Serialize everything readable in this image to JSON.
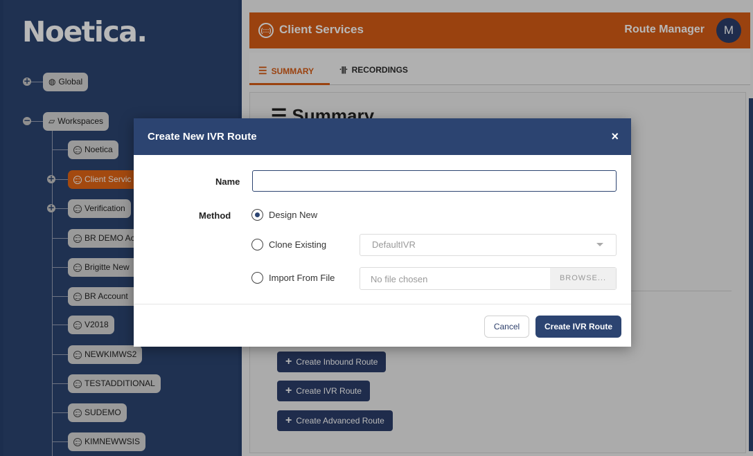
{
  "sidebar": {
    "logo": "Noetica.",
    "global": {
      "toggle": "+",
      "icon": "globe-icon",
      "label": "Global"
    },
    "workspaces": {
      "toggle": "−",
      "icon": "folder-open-icon",
      "label": "Workspaces"
    },
    "items": [
      {
        "label": "Noetica",
        "toggle": ""
      },
      {
        "label": "Client Servic",
        "toggle": "+",
        "active": true
      },
      {
        "label": "Verification",
        "toggle": "+"
      },
      {
        "label": "BR DEMO Ac",
        "toggle": ""
      },
      {
        "label": "Brigitte New",
        "toggle": ""
      },
      {
        "label": "BR Account",
        "toggle": ""
      },
      {
        "label": "V2018",
        "toggle": ""
      },
      {
        "label": "NEWKIMWS2",
        "toggle": ""
      },
      {
        "label": "TESTADDITIONAL",
        "toggle": ""
      },
      {
        "label": "SUDEMO",
        "toggle": ""
      },
      {
        "label": "KIMNEWWSIS",
        "toggle": ""
      }
    ]
  },
  "header": {
    "service_icon": "(:::)",
    "title": "Client Services",
    "right_title": "Route Manager",
    "avatar": "M"
  },
  "tabs": {
    "summary": "SUMMARY",
    "summary_icon": "☰",
    "recordings": "RECORDINGS",
    "recordings_icon": "·|||·"
  },
  "content": {
    "title_icon": "☰",
    "title": "Summary",
    "actions": [
      {
        "icon": "+",
        "label": "Create Inbound Route"
      },
      {
        "icon": "+",
        "label": "Create IVR Route"
      },
      {
        "icon": "+",
        "label": "Create Advanced Route"
      }
    ]
  },
  "modal": {
    "title": "Create New IVR Route",
    "close": "×",
    "name_label": "Name",
    "name_value": "",
    "method_label": "Method",
    "options": {
      "design_new": "Design New",
      "clone_existing": "Clone Existing",
      "import_from_file": "Import From File"
    },
    "selected_method": "design_new",
    "clone_select_value": "DefaultIVR",
    "file_value": "No file chosen",
    "browse_label": "BROWSE...",
    "cancel_label": "Cancel",
    "create_label": "Create IVR Route"
  },
  "colors": {
    "sidebar_bg": "#2c4471",
    "accent_orange": "#d65c16",
    "primary_navy": "#2c3e6a"
  }
}
